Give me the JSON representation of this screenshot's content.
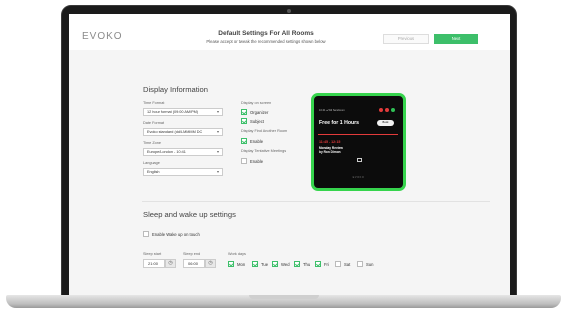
{
  "header": {
    "logo": "EVOKO",
    "title": "Default Settings For All Rooms",
    "subtitle": "Please accept or tweak the recommended settings shown below",
    "prev_label": "Previous",
    "next_label": "Next"
  },
  "display": {
    "title": "Display Information",
    "time_format": {
      "label": "Time Format",
      "value": "12 hour format (09:00 AM/PM)"
    },
    "date_format": {
      "label": "Date Format",
      "value": "Evoko standard (dd/LMMMM DC"
    },
    "time_zone": {
      "label": "Time Zone",
      "value": "Europe/London - 10:41"
    },
    "language": {
      "label": "Language",
      "value": "English"
    },
    "on_screen": {
      "label": "Display on screen",
      "organizer": "Organizer",
      "subject": "Subject"
    },
    "find_room": {
      "label": "Display Find Another Room",
      "option": "Enable"
    },
    "tentative": {
      "label": "Display Tentative Meetings",
      "option": "Enable"
    }
  },
  "preview": {
    "top_text": "10:41  ● Wil Sandorum",
    "free_text": "Free for 1 Hours",
    "book_label": "Book",
    "meeting_time": "11:45 - 12:15",
    "meeting_title": "Monday Review",
    "meeting_organizer": "by Ron Dimon",
    "brand": "EVOKO"
  },
  "sleep": {
    "title": "Sleep and wake up settings",
    "wake_on_touch": "Enable Wake up on touch",
    "sleep_start": {
      "label": "Sleep start",
      "value": "21:00"
    },
    "sleep_end": {
      "label": "Sleep end",
      "value": "06:00"
    },
    "work_days": {
      "label": "Work days",
      "days": [
        {
          "name": "Mon",
          "checked": true
        },
        {
          "name": "Tue",
          "checked": true
        },
        {
          "name": "Wed",
          "checked": true
        },
        {
          "name": "Thu",
          "checked": true
        },
        {
          "name": "Fri",
          "checked": true
        },
        {
          "name": "Sat",
          "checked": false
        },
        {
          "name": "Sun",
          "checked": false
        }
      ]
    }
  },
  "colors": {
    "accent": "#3dbf6a",
    "busy": "#e23b3b",
    "device_border": "#36d44d"
  },
  "icons": {
    "caret": "chevron-down-icon",
    "clock": "clock-icon",
    "calendar": "calendar-icon",
    "checkbox": "check-icon"
  }
}
